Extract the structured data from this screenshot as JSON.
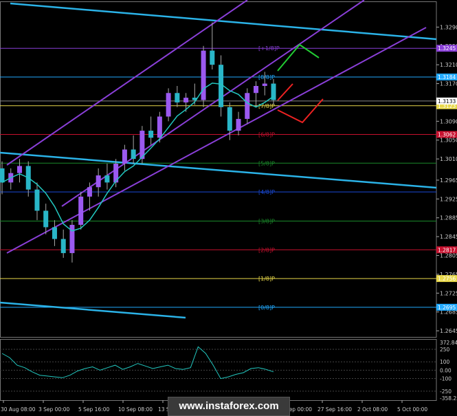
{
  "chart_data": {
    "type": "candlestick",
    "main_panel": {
      "price_ticks": [
        "1.3290",
        "1.3250",
        "1.3210",
        "1.3170",
        "1.3133",
        "1.3090",
        "1.3050",
        "1.3010",
        "1.2965",
        "1.2925",
        "1.2885",
        "1.2845",
        "1.2805",
        "1.2765",
        "1.2725",
        "1.2685",
        "1.2645"
      ],
      "price_ylim": [
        1.2632,
        1.333
      ],
      "levels": [
        {
          "label": "[+1/8]P",
          "price": 1.3245,
          "color": "#8a3fd8",
          "tag": "1.3245"
        },
        {
          "label": "[8/8]P",
          "price": 1.3184,
          "color": "#22aaff",
          "tag": "1.3184"
        },
        {
          "label": "[7/8]P",
          "price": 1.3123,
          "color": "#e8d84a",
          "tag": "1.3123"
        },
        {
          "label": "[6/8]P",
          "price": 1.3062,
          "color": "#c8102e",
          "tag": "1.3062"
        },
        {
          "label": "[5/8]P",
          "price": 1.3001,
          "color": "#1a8a2a",
          "tag": ""
        },
        {
          "label": "[4/8]P",
          "price": 1.294,
          "color": "#1a4ad8",
          "tag": ""
        },
        {
          "label": "[3/8]P",
          "price": 1.2878,
          "color": "#1a8a2a",
          "tag": ""
        },
        {
          "label": "[2/8]P",
          "price": 1.2817,
          "color": "#c8102e",
          "tag": "1.2817"
        },
        {
          "label": "[1/8]P",
          "price": 1.2756,
          "color": "#e8d84a",
          "tag": "1.2756"
        },
        {
          "label": "[0/8]P",
          "price": 1.2695,
          "color": "#22aaff",
          "tag": "1.2695"
        }
      ],
      "current_price_tag": "1.3133",
      "ohlc_approx": [
        [
          1.299,
          1.3005,
          1.2935,
          1.296
        ],
        [
          1.296,
          1.299,
          1.2945,
          1.298
        ],
        [
          1.298,
          1.301,
          1.296,
          1.2995
        ],
        [
          1.2995,
          1.3005,
          1.293,
          1.2945
        ],
        [
          1.2945,
          1.296,
          1.288,
          1.29
        ],
        [
          1.29,
          1.2915,
          1.285,
          1.2865
        ],
        [
          1.2865,
          1.288,
          1.2825,
          1.284
        ],
        [
          1.284,
          1.286,
          1.28,
          1.281
        ],
        [
          1.281,
          1.288,
          1.279,
          1.287
        ],
        [
          1.287,
          1.294,
          1.286,
          1.293
        ],
        [
          1.293,
          1.296,
          1.29,
          1.295
        ],
        [
          1.295,
          1.299,
          1.293,
          1.2975
        ],
        [
          1.2975,
          1.3,
          1.2945,
          1.296
        ],
        [
          1.296,
          1.301,
          1.295,
          1.3
        ],
        [
          1.3,
          1.304,
          1.2985,
          1.303
        ],
        [
          1.303,
          1.306,
          1.3,
          1.301
        ],
        [
          1.301,
          1.308,
          1.3,
          1.307
        ],
        [
          1.307,
          1.31,
          1.304,
          1.3055
        ],
        [
          1.3055,
          1.311,
          1.3045,
          1.31
        ],
        [
          1.31,
          1.316,
          1.309,
          1.315
        ],
        [
          1.315,
          1.3165,
          1.312,
          1.313
        ],
        [
          1.313,
          1.315,
          1.311,
          1.314
        ],
        [
          1.314,
          1.317,
          1.3125,
          1.3135
        ],
        [
          1.3135,
          1.325,
          1.312,
          1.324
        ],
        [
          1.324,
          1.33,
          1.32,
          1.321
        ],
        [
          1.321,
          1.323,
          1.31,
          1.312
        ],
        [
          1.312,
          1.313,
          1.305,
          1.307
        ],
        [
          1.307,
          1.311,
          1.306,
          1.3095
        ],
        [
          1.3095,
          1.316,
          1.3085,
          1.315
        ],
        [
          1.315,
          1.3175,
          1.312,
          1.3165
        ],
        [
          1.3165,
          1.3195,
          1.3145,
          1.317
        ],
        [
          1.317,
          1.318,
          1.3125,
          1.3135
        ]
      ]
    },
    "cci_panel": {
      "ticks": [
        "372.8496",
        "250",
        "100",
        "0.00",
        "-100",
        "-250",
        "-358.25"
      ],
      "ylim": [
        -358.25,
        372.8496
      ],
      "values": [
        200,
        150,
        60,
        30,
        -20,
        -60,
        -70,
        -80,
        -90,
        -60,
        -10,
        20,
        40,
        0,
        30,
        60,
        10,
        40,
        80,
        50,
        20,
        40,
        60,
        20,
        10,
        30,
        280,
        200,
        60,
        -100,
        -80,
        -50,
        -30,
        20,
        30,
        10,
        -20
      ]
    },
    "x_axis_labels": [
      "30 Aug 08:00",
      "3 Sep 00:00",
      "5 Sep 16:00",
      "10 Sep 08:00",
      "13 Sep 00:00",
      "17 Sep 16:00",
      "20 Sep 08:00",
      "25 Sep 00:00",
      "27 Sep 16:00",
      "2 Oct 08:00",
      "5 Oct 00:00"
    ]
  },
  "watermark": "www.instaforex.com"
}
